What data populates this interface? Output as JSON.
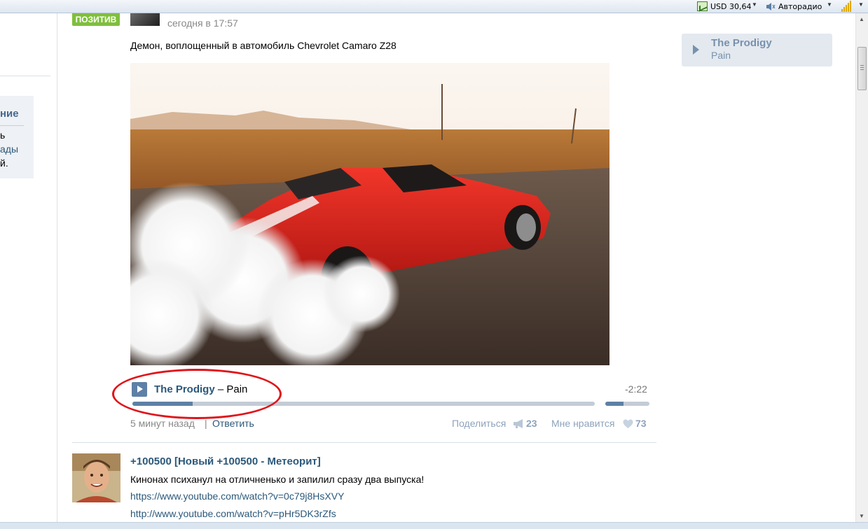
{
  "toolbar": {
    "currency_label": "USD 30,64",
    "radio_label": "Авторадио",
    "currency_icon": "chart-icon",
    "radio_icon": "speaker-icon",
    "signal_icon": "signal-bars-icon"
  },
  "left_sidebar": {
    "title_fragment": "ние",
    "line1": "ь",
    "line2": "ады",
    "line3": "й."
  },
  "post": {
    "group_logo_text": "ПОЗИТИВ",
    "time": "сегодня в 17:57",
    "text": "Демон, воплощенный в автомобиль Chevrolet Camaro Z28",
    "audio": {
      "artist": "The Prodigy",
      "separator": " – ",
      "title": "Pain",
      "remaining": "-2:22",
      "progress": 0.13,
      "volume": 0.42
    },
    "footer": {
      "time_ago": "5 минут назад",
      "separator": "|",
      "reply": "Ответить",
      "share": "Поделиться",
      "share_count": "23",
      "like": "Мне нравится",
      "like_count": "73"
    }
  },
  "post2": {
    "title": "+100500 [Новый +100500 - Метеорит]",
    "text": "Кинонах психанул на отличненько и запилил сразу два выпуска!",
    "link1": "https://www.youtube.com/watch?v=0c79j8HsXVY",
    "link2": "http://www.youtube.com/watch?v=pHr5DK3rZfs"
  },
  "right_player": {
    "artist": "The Prodigy",
    "title": "Pain"
  },
  "colors": {
    "link": "#2b587a",
    "accent": "#5e80a7",
    "highlight": "#e0141a"
  }
}
